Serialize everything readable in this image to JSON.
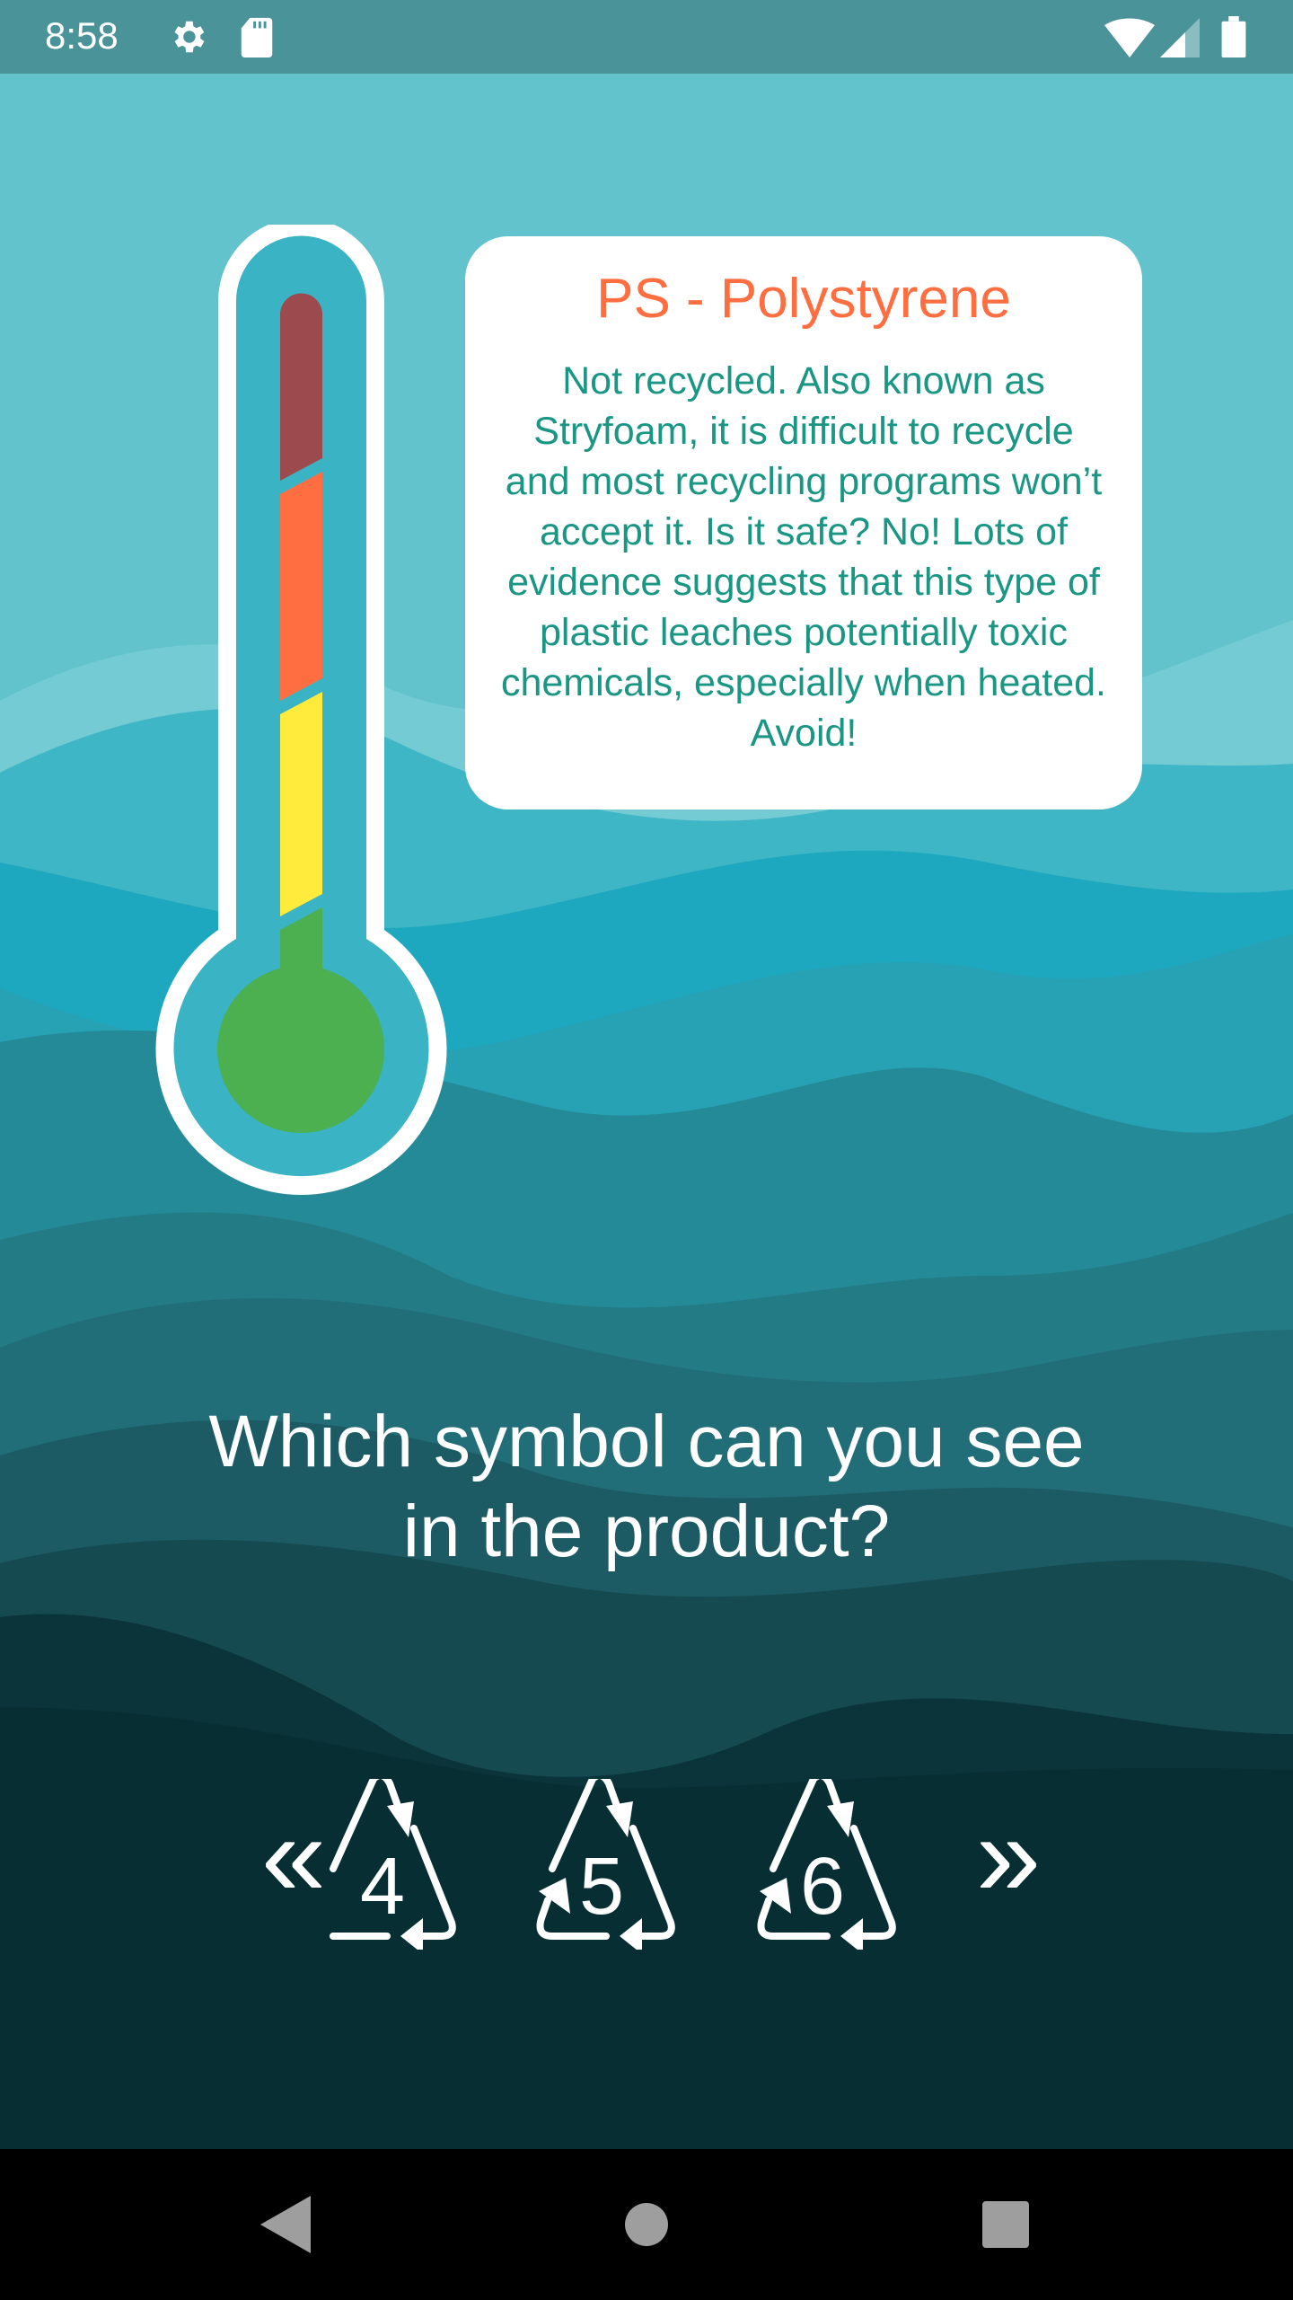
{
  "status_bar": {
    "time": "8:58",
    "icons": [
      "gear-icon",
      "sd-card-icon",
      "wifi-icon",
      "signal-icon",
      "battery-icon"
    ]
  },
  "thermometer": {
    "levels": [
      "red",
      "orange",
      "yellow",
      "green"
    ],
    "colors": {
      "red": "#9c4a4e",
      "orange": "#ff6e40",
      "yellow": "#ffeb3b",
      "green": "#4caf50"
    }
  },
  "info_card": {
    "title": "PS - Polystyrene",
    "body": "Not recycled. Also known as Stryfoam, it is difficult to recycle and most recycling programs won’t accept it. Is it safe? No! Lots of evidence suggests that this type of plastic leaches potentially toxic chemicals, especially when heated. Avoid!"
  },
  "question": {
    "line1": "Which symbol can you see",
    "line2": "in the product?"
  },
  "carousel": {
    "prev": "«",
    "next": "»",
    "symbols": [
      "4",
      "5",
      "6"
    ]
  },
  "nav_bar": {
    "buttons": [
      "back",
      "home",
      "recents"
    ]
  },
  "colors": {
    "title": "#ff6e40",
    "body": "#1a9685",
    "status_bar": "#4a9399"
  }
}
